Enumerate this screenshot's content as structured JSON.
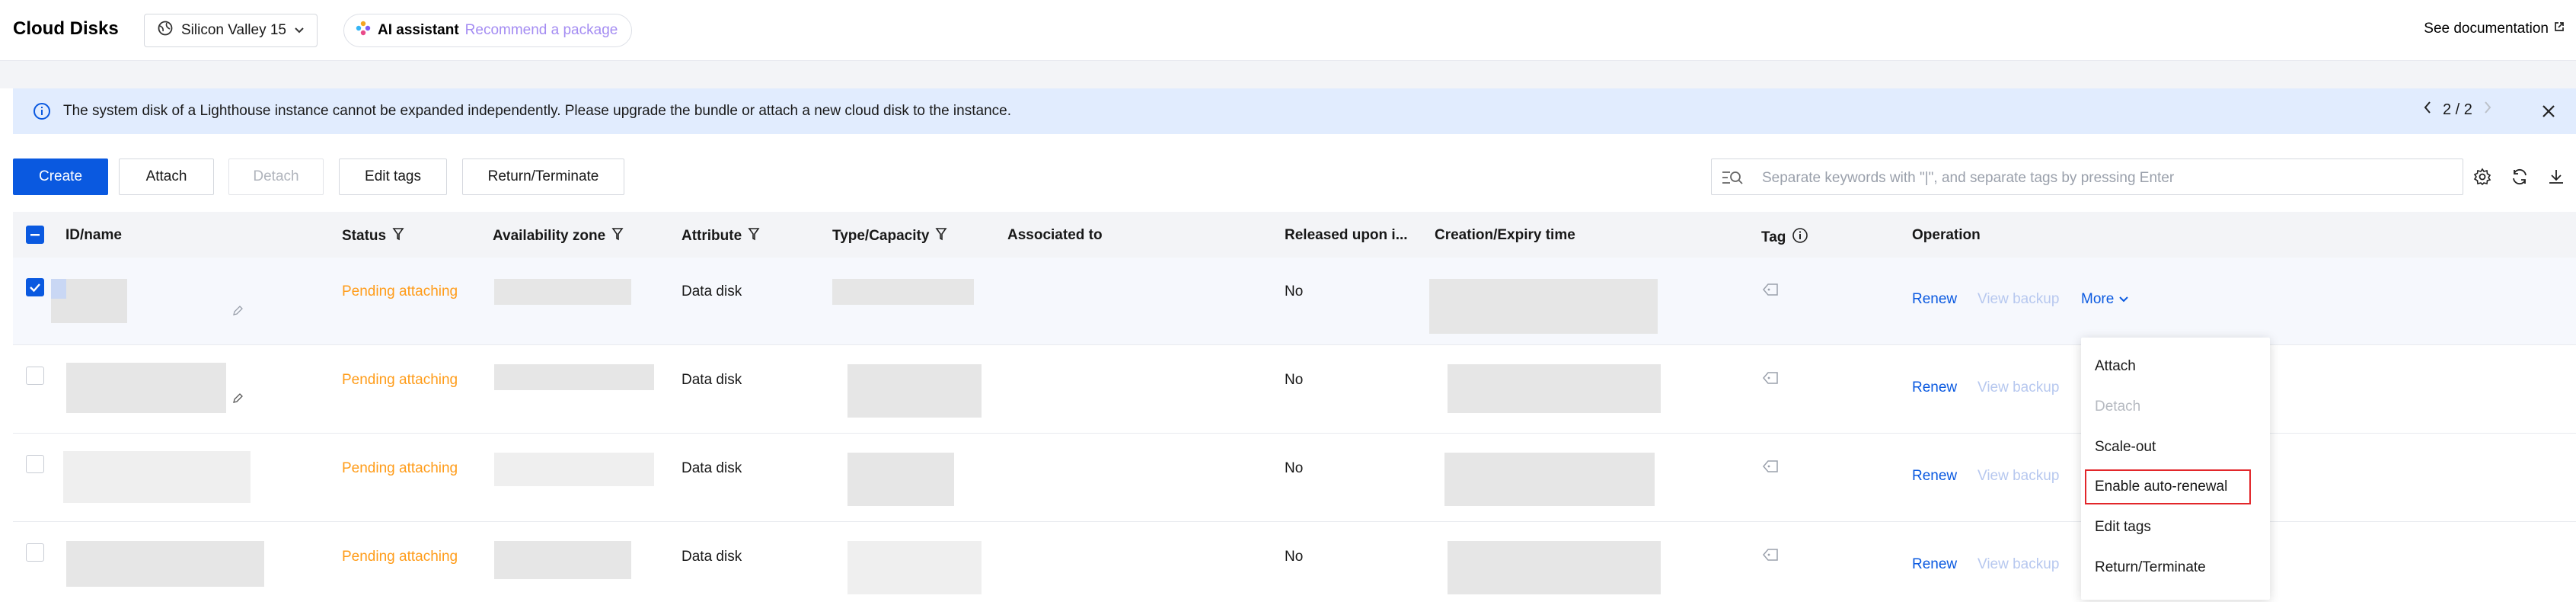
{
  "header": {
    "title": "Cloud Disks",
    "region": "Silicon Valley 15",
    "ai_label": "AI assistant",
    "ai_link": "Recommend a package",
    "doc_link": "See documentation"
  },
  "notice": {
    "message": "The system disk of a Lighthouse instance cannot be expanded independently. Please upgrade the bundle or attach a new cloud disk to the instance.",
    "pager": "2 / 2"
  },
  "toolbar": {
    "create": "Create",
    "attach": "Attach",
    "detach": "Detach",
    "edit_tags": "Edit tags",
    "return_terminate": "Return/Terminate"
  },
  "search": {
    "placeholder": "Separate keywords with \"|\", and separate tags by pressing Enter"
  },
  "table": {
    "headers": {
      "id_name": "ID/name",
      "status": "Status",
      "zone": "Availability zone",
      "attribute": "Attribute",
      "type_capacity": "Type/Capacity",
      "associated": "Associated to",
      "released": "Released upon i...",
      "creation": "Creation/Expiry time",
      "tag": "Tag",
      "operation": "Operation"
    },
    "rows": [
      {
        "status": "Pending attaching",
        "attribute": "Data disk",
        "released": "No",
        "renew": "Renew",
        "backup": "View backup",
        "more": "More",
        "selected": true
      },
      {
        "status": "Pending attaching",
        "attribute": "Data disk",
        "released": "No",
        "renew": "Renew",
        "backup": "View backup",
        "selected": false
      },
      {
        "status": "Pending attaching",
        "attribute": "Data disk",
        "released": "No",
        "renew": "Renew",
        "backup": "View backup",
        "selected": false
      },
      {
        "status": "Pending attaching",
        "attribute": "Data disk",
        "released": "No",
        "renew": "Renew",
        "backup": "View backup",
        "selected": false
      }
    ]
  },
  "more_menu": {
    "items": [
      {
        "label": "Attach",
        "disabled": false
      },
      {
        "label": "Detach",
        "disabled": true
      },
      {
        "label": "Scale-out",
        "disabled": false
      },
      {
        "label": "Enable auto-renewal",
        "disabled": false,
        "highlighted": true
      },
      {
        "label": "Edit tags",
        "disabled": false
      },
      {
        "label": "Return/Terminate",
        "disabled": false
      }
    ]
  },
  "colors": {
    "primary": "#0a59e0",
    "status_pending": "#ff9c19",
    "notice_bg": "#e1ecfe",
    "highlight_border": "#e2262a"
  },
  "icons": [
    "globe-icon",
    "chevron-down-icon",
    "ai-sparkle-icon",
    "external-link-icon",
    "info-icon",
    "chevron-left-icon",
    "chevron-right-icon",
    "close-icon",
    "search-filter-icon",
    "settings-gear-icon",
    "refresh-icon",
    "download-icon",
    "filter-icon",
    "tag-icon",
    "edit-pencil-icon"
  ]
}
